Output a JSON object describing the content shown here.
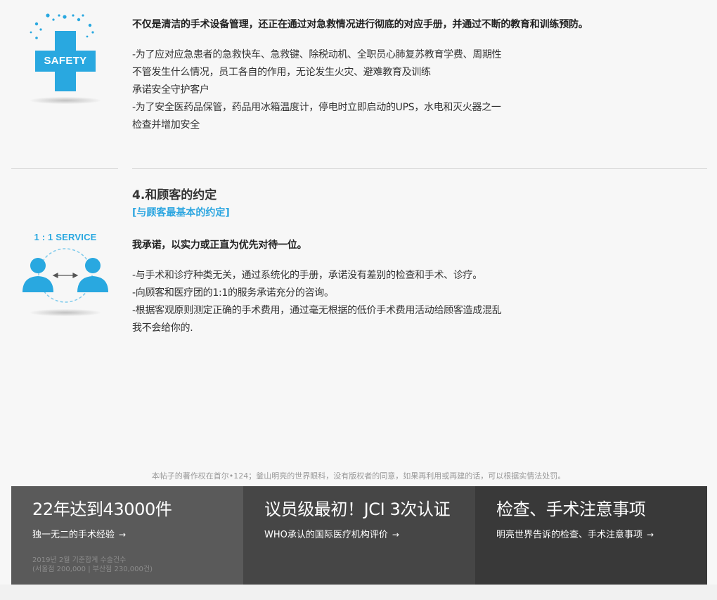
{
  "safety": {
    "icon_label": "SAFETY",
    "lead": "不仅是清洁的手术设备管理，还正在通过对急救情况进行彻底的对应手册，并通过不断的教育和训练预防。",
    "lines": [
      "-为了应对应急患者的急救快车、急救键、除税动机、全职员心肺复苏教育学费、周期性",
      "不管发生什么情况，员工各自的作用，无论发生火灾、避难教育及训练",
      "承诺安全守护客户",
      "-为了安全医药品保管，药品用冰箱温度计，停电时立即启动的UPS，水电和灭火器之一",
      "检查并增加安全"
    ]
  },
  "service": {
    "icon_label": "1 : 1 SERVICE",
    "title": "4.和顾客的约定",
    "subtitle": "[与顾客最基本的约定]",
    "lead": "我承诺，以实力或正直为优先对待一位。",
    "lines": [
      "-与手术和诊疗种类无关，通过系统化的手册，承诺没有差别的检查和手术、诊疗。",
      "-向顾客和医疗团的1:1的服务承诺充分的咨询。",
      "-根据客观原则测定正确的手术费用，通过毫无根据的低价手术费用活动给顾客造成混乱",
      "我不会给你的."
    ]
  },
  "copyright": "本帖子的著作权在首尔•124；釜山明亮的世界眼科，没有版权者的同意，如果再利用或再建的话，可以根据实情法处罚。",
  "footer": {
    "cards": [
      {
        "title": "22年达到43000件",
        "link": "独一无二的手术经验",
        "arrow": "→",
        "note1": "2019년 2월 기준합계 수술건수",
        "note2": "(서울점 200,000 | 부산점 230,000건)"
      },
      {
        "title": "议员级最初！JCI 3次认证",
        "link": "WHO承认的国际医疗机构评价",
        "arrow": "→"
      },
      {
        "title": "检查、手术注意事项",
        "link": "明亮世界告诉的检查、手术注意事项",
        "arrow": "→"
      }
    ]
  },
  "colors": {
    "accent_blue": "#2aa5e0",
    "icon_blue": "#29a8e0",
    "card1_bg": "#5a5a5a",
    "card2_bg": "#464646",
    "card3_bg": "#393939"
  }
}
